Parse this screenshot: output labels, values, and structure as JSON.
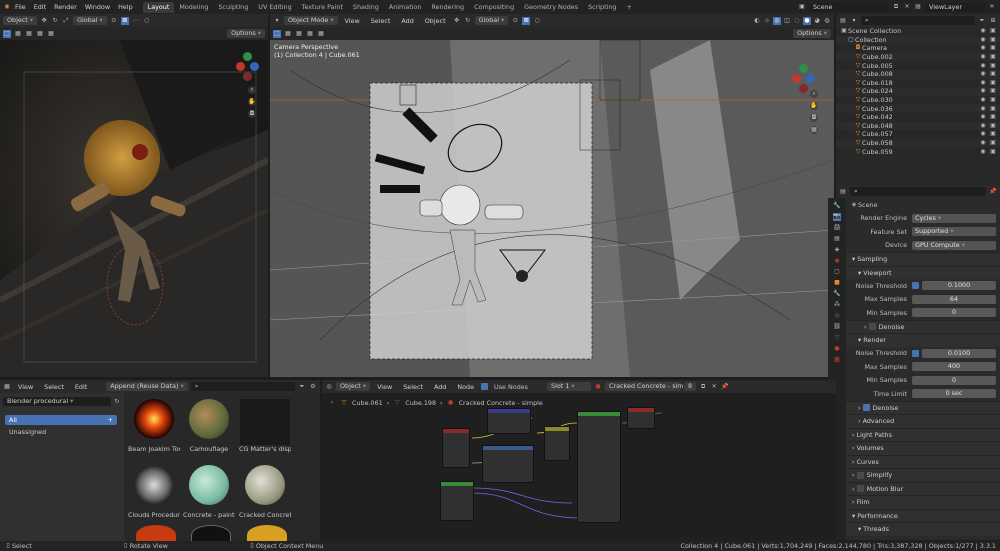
{
  "topbar": {
    "menus": [
      "File",
      "Edit",
      "Render",
      "Window",
      "Help"
    ],
    "workspaces": [
      "Layout",
      "Modeling",
      "Sculpting",
      "UV Editing",
      "Texture Paint",
      "Shading",
      "Animation",
      "Rendering",
      "Compositing",
      "Geometry Nodes",
      "Scripting"
    ],
    "active_workspace": "Layout",
    "add_tab": "+",
    "scene": "Scene",
    "view_layer": "ViewLayer"
  },
  "left_viewport": {
    "mode": "Object",
    "transform": "Global",
    "options": "Options"
  },
  "main_viewport": {
    "mode": "Object Mode",
    "menus": [
      "View",
      "Select",
      "Add",
      "Object"
    ],
    "transform": "Global",
    "options": "Options",
    "overlay_line1": "Camera Perspective",
    "overlay_line2": "(1) Collection 4 | Cube.061"
  },
  "outliner": {
    "search_placeholder": "",
    "items": [
      {
        "name": "Scene Collection",
        "indent": 0
      },
      {
        "name": "Collection",
        "indent": 1
      },
      {
        "name": "Camera",
        "indent": 2
      },
      {
        "name": "Cube.002",
        "indent": 2
      },
      {
        "name": "Cube.005",
        "indent": 2
      },
      {
        "name": "Cube.008",
        "indent": 2
      },
      {
        "name": "Cube.018",
        "indent": 2
      },
      {
        "name": "Cube.024",
        "indent": 2
      },
      {
        "name": "Cube.030",
        "indent": 2
      },
      {
        "name": "Cube.036",
        "indent": 2
      },
      {
        "name": "Cube.042",
        "indent": 2
      },
      {
        "name": "Cube.048",
        "indent": 2
      },
      {
        "name": "Cube.057",
        "indent": 2
      },
      {
        "name": "Cube.058",
        "indent": 2
      },
      {
        "name": "Cube.059",
        "indent": 2
      }
    ]
  },
  "properties": {
    "context": "Scene",
    "render_engine_label": "Render Engine",
    "render_engine": "Cycles",
    "feature_set_label": "Feature Set",
    "feature_set": "Supported",
    "device_label": "Device",
    "device": "GPU Compute",
    "sampling": "Sampling",
    "viewport": "Viewport",
    "noise_threshold_label": "Noise Threshold",
    "vp_noise_threshold": "0.1000",
    "max_samples_label": "Max Samples",
    "vp_max_samples": "64",
    "min_samples_label": "Min Samples",
    "vp_min_samples": "0",
    "denoise": "Denoise",
    "render": "Render",
    "r_noise_threshold": "0.0100",
    "r_max_samples": "400",
    "r_min_samples": "0",
    "time_limit_label": "Time Limit",
    "time_limit": "0 sec",
    "advanced": "Advanced",
    "light_paths": "Light Paths",
    "volumes": "Volumes",
    "curves": "Curves",
    "simplify": "Simplify",
    "motion_blur": "Motion Blur",
    "film": "Film",
    "performance": "Performance",
    "threads": "Threads"
  },
  "assets": {
    "menus": [
      "View",
      "Select",
      "Edit"
    ],
    "import_mode": "Append (Reuse Data)",
    "library": "Blender procedural",
    "catalog_all": "All",
    "catalog_unassigned": "Unassigned",
    "items": [
      "Beam Joakim Tom...",
      "Camouflage",
      "CG Matter's disp...",
      "Clouds Procedural ...",
      "Concrete - painted...",
      "Cracked Concrete -..."
    ]
  },
  "node_editor": {
    "mode": "Object",
    "menus": [
      "View",
      "Select",
      "Add",
      "Node"
    ],
    "use_nodes": "Use Nodes",
    "slot": "Slot 1",
    "material": "Cracked Concrete - simple",
    "users": "8",
    "breadcrumb": [
      "Cube.061",
      "Cube.198",
      "Cracked Concrete - simple"
    ]
  },
  "status": {
    "select": "Select",
    "rotate": "Rotate View",
    "context_menu": "Object Context Menu",
    "stats": "Collection 4 | Cube.061 | Verts:1,704,249 | Faces:2,144,780 | Tris:3,387,328 | Objects:1/277 | 3.3.1"
  },
  "colors": {
    "accent": "#4772b3",
    "active_tab": "#3a3a3a",
    "orange": "#e8892a"
  }
}
